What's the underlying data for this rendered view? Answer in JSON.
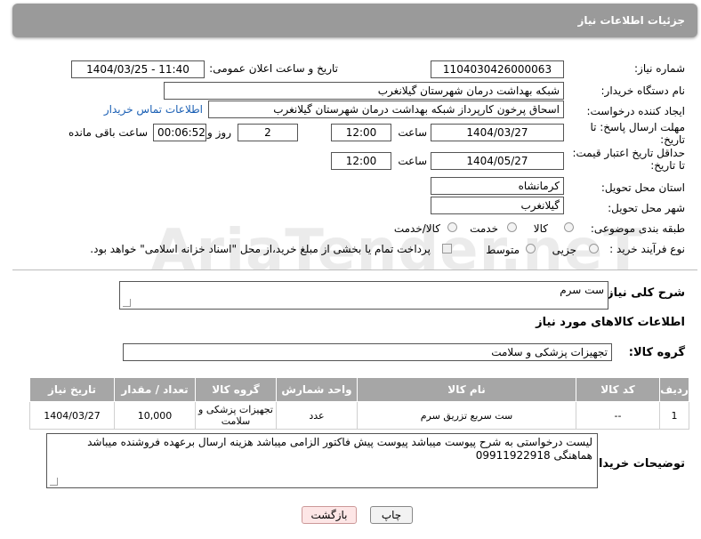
{
  "header": {
    "title": "جزئیات اطلاعات نیاز"
  },
  "form": {
    "need_number": {
      "label": "شماره نیاز:",
      "value": "1104030426000063"
    },
    "announce_datetime": {
      "label": "تاریخ و ساعت اعلان عمومی:",
      "value": "1404/03/25 - 11:40"
    },
    "buyer_org": {
      "label": "نام دستگاه خریدار:",
      "value": "شبکه بهداشت درمان شهرستان گیلانغرب"
    },
    "requester": {
      "label": "ایجاد کننده درخواست:",
      "value": "اسحاق پرخون کارپرداز شبکه بهداشت درمان شهرستان گیلانغرب",
      "contact_link": "اطلاعات تماس خریدار"
    },
    "reply_deadline": {
      "label": "مهلت ارسال پاسخ: تا تاریخ:",
      "date": "1404/03/27",
      "time_label": "ساعت",
      "time": "12:00",
      "days": "2",
      "days_label": "روز و",
      "remaining": "00:06:52",
      "remaining_label": "ساعت باقی مانده"
    },
    "price_validity": {
      "label": "حداقل تاریخ اعتبار قیمت: تا تاریخ:",
      "date": "1404/05/27",
      "time_label": "ساعت",
      "time": "12:00"
    },
    "province": {
      "label": "استان محل تحویل:",
      "value": "کرمانشاه"
    },
    "city": {
      "label": "شهر محل تحویل:",
      "value": "گیلانغرب"
    },
    "category": {
      "label": "طبقه بندی موضوعی:",
      "options": [
        "کالا",
        "خدمت",
        "کالا/خدمت"
      ]
    },
    "process_type": {
      "label": "نوع فرآیند خرید :",
      "options": [
        "جزیی",
        "متوسط"
      ],
      "note": "پرداخت تمام یا بخشی از مبلغ خرید،از محل \"اسناد خزانه اسلامی\" خواهد بود."
    }
  },
  "description": {
    "label": "شرح کلی نیاز:",
    "value": "ست سرم"
  },
  "goods_info": {
    "title": "اطلاعات کالاهای مورد نیاز"
  },
  "goods_group": {
    "label": "گروه کالا:",
    "value": "تجهیزات پزشکی و سلامت"
  },
  "table": {
    "headers": [
      "ردیف",
      "کد کالا",
      "نام کالا",
      "واحد شمارش",
      "گروه کالا",
      "تعداد / مقدار",
      "تاریخ نیاز"
    ],
    "rows": [
      [
        "1",
        "--",
        "ست سربع تزریق سرم",
        "عدد",
        "تجهیزات پزشکی و سلامت",
        "10,000",
        "1404/03/27"
      ]
    ]
  },
  "buyer_notes": {
    "label": "توضیحات خریدار:",
    "value": "لیست درخواستی به شرح پیوست میباشد پیوست پیش فاکتور الزامی میباشد هزینه ارسال برعهده فروشنده میباشد هماهنگی 09911922918"
  },
  "buttons": {
    "print": "چاپ",
    "back": "بازگشت"
  },
  "watermark": {
    "text": "AriaTender.neT"
  }
}
